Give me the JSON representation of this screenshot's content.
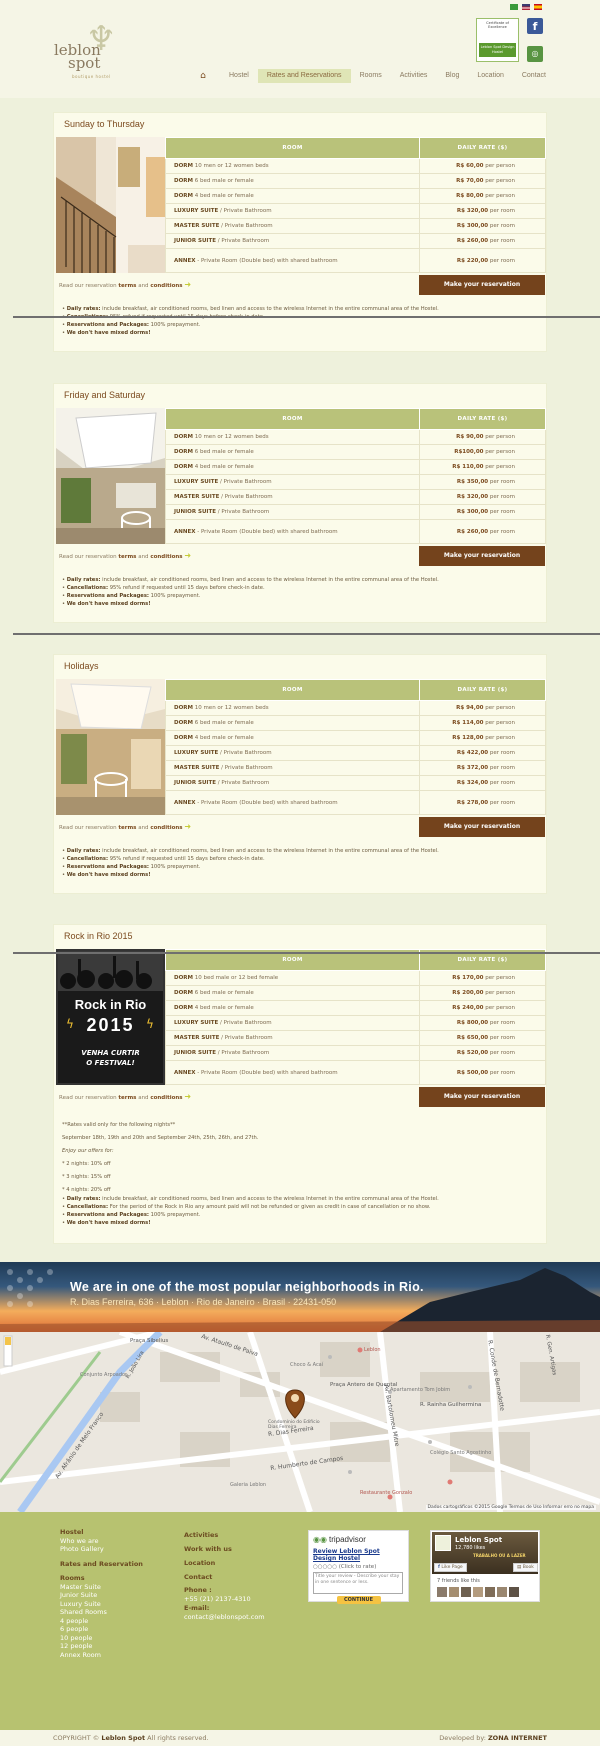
{
  "header": {
    "logo_line1": "leblon",
    "logo_line2": "spot",
    "logo_sub": "boutique hostel",
    "certificate_top": "Certificate of Excellence",
    "certificate_bottom": "Leblon Spot Design Hostel",
    "facebook_glyph": "f",
    "nav": {
      "home_icon": "home-icon",
      "items": [
        "Hostel",
        "Rates and Reservations",
        "Rooms",
        "Activities",
        "Blog",
        "Location",
        "Contact"
      ],
      "active": "Rates and Reservations"
    }
  },
  "table_headers": {
    "room": "ROOM",
    "rate": "DAILY RATE ($)"
  },
  "read_our": "Read our reservation",
  "terms": "terms",
  "and": "and",
  "conditions": "conditions",
  "make_reservation": "Make your reservation",
  "sections": [
    {
      "title": "Sunday to Thursday",
      "rows": [
        {
          "room_bold": "DORM",
          "room_rest": " 10 men or 12 women beds",
          "price": "R$ 60,00",
          "unit": " per person"
        },
        {
          "room_bold": "DORM",
          "room_rest": "  6 bed male or female",
          "price": "R$ 70,00",
          "unit": " per person"
        },
        {
          "room_bold": "DORM",
          "room_rest": "  4 bed male or female",
          "price": "R$ 80,00",
          "unit": " per person"
        },
        {
          "room_bold": "LUXURY SUITE",
          "room_rest": " / Private Bathroom",
          "price": "R$ 320,00",
          "unit": " per room"
        },
        {
          "room_bold": "MASTER SUITE",
          "room_rest": " / Private Bathroom",
          "price": "R$ 300,00",
          "unit": " per room"
        },
        {
          "room_bold": "JUNIOR SUITE",
          "room_rest": " / Private Bathroom",
          "price": "R$ 260,00",
          "unit": " per room"
        },
        {
          "room_bold": "ANNEX",
          "room_rest": " - Private Room (Double bed) with shared bathroom",
          "price": "R$ 220,00",
          "unit": " per room"
        }
      ],
      "notes": [
        {
          "b": "Daily rates:",
          "t": " include breakfast, air conditioned rooms, bed linen and access to the wireless Internet in the entire communal area of the Hostel."
        },
        {
          "b": "Cancellations:",
          "t": " 95% refund if requested until 15 days before check-in date."
        },
        {
          "b": "Reservations and Packages:",
          "t": " 100% prepayment."
        },
        {
          "b": "We don't have mixed dorms!",
          "t": ""
        }
      ]
    },
    {
      "title": "Friday and Saturday",
      "rows": [
        {
          "room_bold": "DORM",
          "room_rest": " 10 men or 12 women beds",
          "price": "R$ 90,00",
          "unit": " per person"
        },
        {
          "room_bold": "DORM",
          "room_rest": "  6 bed male or female",
          "price": "R$100,00",
          "unit": " per person"
        },
        {
          "room_bold": "DORM",
          "room_rest": "  4 bed male or female",
          "price": "R$ 110,00",
          "unit": " per person"
        },
        {
          "room_bold": "LUXURY SUITE",
          "room_rest": " / Private Bathroom",
          "price": "R$ 350,00",
          "unit": " per room"
        },
        {
          "room_bold": "MASTER SUITE",
          "room_rest": " / Private Bathroom",
          "price": "R$ 320,00",
          "unit": " per room"
        },
        {
          "room_bold": "JUNIOR SUITE",
          "room_rest": " / Private Bathroom",
          "price": "R$ 300,00",
          "unit": " per room"
        },
        {
          "room_bold": "ANNEX",
          "room_rest": " - Private Room (Double bed) with shared bathroom",
          "price": "R$ 260,00",
          "unit": " per room"
        }
      ],
      "notes": [
        {
          "b": "Daily rates:",
          "t": " include breakfast, air conditioned rooms, bed linen and access to the wireless Internet in the entire communal area of the Hostel."
        },
        {
          "b": "Cancellations:",
          "t": " 95% refund if requested until 15 days before check-in date."
        },
        {
          "b": "Reservations and Packages:",
          "t": " 100% prepayment."
        },
        {
          "b": "We don't have mixed dorms!",
          "t": ""
        }
      ]
    },
    {
      "title": "Holidays",
      "rows": [
        {
          "room_bold": "DORM",
          "room_rest": " 10 men or 12 women beds",
          "price": "R$ 94,00",
          "unit": " per person"
        },
        {
          "room_bold": "DORM",
          "room_rest": "  6 bed male or female",
          "price": "R$ 114,00",
          "unit": " per person"
        },
        {
          "room_bold": "DORM",
          "room_rest": "  4 bed male or female",
          "price": "R$ 128,00",
          "unit": " per person"
        },
        {
          "room_bold": "LUXURY SUITE",
          "room_rest": " / Private Bathroom",
          "price": "R$ 422,00",
          "unit": " per room"
        },
        {
          "room_bold": "MASTER SUITE",
          "room_rest": " / Private Bathroom",
          "price": "R$ 372,00",
          "unit": " per room"
        },
        {
          "room_bold": "JUNIOR SUITE",
          "room_rest": " / Private Bathroom",
          "price": "R$ 324,00",
          "unit": " per room"
        },
        {
          "room_bold": "ANNEX",
          "room_rest": " - Private Room (Double bed) with shared bathroom",
          "price": "R$ 278,00",
          "unit": " per room"
        }
      ],
      "notes": [
        {
          "b": "Daily rates:",
          "t": " include breakfast, air conditioned rooms, bed linen and access to the wireless Internet in the entire communal area of the Hostel."
        },
        {
          "b": "Cancellations:",
          "t": " 95% refund if requested until 15 days before check-in date."
        },
        {
          "b": "Reservations and Packages:",
          "t": " 100% prepayment."
        },
        {
          "b": "We don't have mixed dorms!",
          "t": ""
        }
      ]
    },
    {
      "title": "Rock in Rio 2015",
      "rows": [
        {
          "room_bold": "DORM",
          "room_rest": " 10 bed male or 12 bed female",
          "price": "R$ 170,00",
          "unit": " per person"
        },
        {
          "room_bold": "DORM",
          "room_rest": " 6 bed male or female",
          "price": "R$ 200,00",
          "unit": " per person"
        },
        {
          "room_bold": "DORM",
          "room_rest": " 4 bed male or female",
          "price": "R$ 240,00",
          "unit": " per person"
        },
        {
          "room_bold": "LUXURY SUITE",
          "room_rest": " / Private Bathroom",
          "price": "R$ 800,00",
          "unit": " per room"
        },
        {
          "room_bold": "MASTER SUITE",
          "room_rest": " / Private Bathroom",
          "price": "R$ 650,00",
          "unit": " per room"
        },
        {
          "room_bold": "JUNIOR SUITE",
          "room_rest": " / Private Bathroom",
          "price": "R$ 520,00",
          "unit": " per room"
        },
        {
          "room_bold": "ANNEX",
          "room_rest": " - Private Room (Double bed) with shared bathroom",
          "price": "R$ 500,00",
          "unit": " per room"
        }
      ],
      "rock_image": {
        "line1": "Rock in Rio",
        "line2": "2015",
        "line3": "VENHA CURTIR",
        "line4": "O FESTIVAL!"
      },
      "extra": {
        "valid": "**Rates valid only for the following nights**",
        "dates": "September 18th, 19th and 20th and September 24th, 25th, 26th, and 27th.",
        "enjoy": "Enjoy our offers for:",
        "offers": [
          "* 2 nights: 10% off",
          "* 3 nights: 15% off",
          "* 4 nights: 20% off"
        ]
      },
      "notes": [
        {
          "b": "Daily rates:",
          "t": " include breakfast, air conditioned rooms, bed linen and access to the wireless Internet in the entire communal area of the Hostel."
        },
        {
          "b": "Cancellations:",
          "t": " For the period of the Rock in Rio any amount paid will not be refunded or given as credit in case of cancellation or no show."
        },
        {
          "b": "Reservations and Packages:",
          "t": " 100% prepayment."
        },
        {
          "b": "We don't have mixed dorms!",
          "t": ""
        }
      ]
    }
  ],
  "banner": {
    "headline": "We are in one of the most popular neighborhoods in Rio.",
    "address": "R. Dias Ferreira, 636 · Leblon · Rio de Janeiro · Brasil · 22431-050"
  },
  "map": {
    "streets": [
      "R. Dias Ferreira",
      "Av. Ataulfo de Paiva",
      "R. Humberto de Campos",
      "Av. Bartolomeu Mitre",
      "Av. Afrânio de Melo Franco",
      "R. Conde de Bernadotte",
      "Praça Antero de Quental",
      "R. Rainha Guilhermina",
      "R. João Lira",
      "R. Gen. Artigas",
      "Praça Sibelius"
    ],
    "pois": [
      "Leblon",
      "Choco & Acaí",
      "Colégio Santo Agostinho",
      "Apartamento Tom Jobim",
      "Condomínio do Edifício Dias Ferreira",
      "Restaurante Gonzalo",
      "Galeria Leblon",
      "Conjunto Arpoador"
    ],
    "copyright": "Dados cartográficos ©2015 Google   Termos de Uso   Informar erro no mapa"
  },
  "footer": {
    "col1": {
      "items": [
        "Hostel",
        "Who we are",
        "Photo Gallery",
        "Rates and Reservation",
        "Rooms",
        "Master Suite",
        "Junior Suite",
        "Luxury Suite",
        "Shared Rooms",
        "4 people",
        "6 people",
        "10 people",
        "12 people",
        "Annex Room"
      ],
      "heads": [
        "Hostel",
        "Rates and Reservation",
        "Rooms"
      ]
    },
    "col2": {
      "activities": "Activities",
      "work": "Work with us",
      "location": "Location",
      "contact": "Contact",
      "phone_label": "Phone :",
      "phone": "+55 (21) 2137-4310",
      "email_label": "E-mail:",
      "email": "contact@leblonspot.com"
    },
    "tripadvisor": {
      "logo": "tripadvisor",
      "review": "Review Leblon Spot Design Hostel",
      "rate": "(Click to rate)",
      "placeholder": "Title your review - Describe your stay in one sentence or less.",
      "button": "CONTINUE"
    },
    "facebook": {
      "name": "Leblon Spot",
      "likes": "12,780 likes",
      "promo": "TRABALHO OU A LAZER",
      "like_page": "Like Page",
      "book": "Book",
      "friends": "7 friends like this"
    }
  },
  "copyright": {
    "left_pre": "COPYRIGHT © ",
    "left_bold": "Leblon Spot",
    "left_post": " All rights reserved.",
    "right_pre": "Developed by: ",
    "right_bold": "ZONA INTERNET"
  }
}
